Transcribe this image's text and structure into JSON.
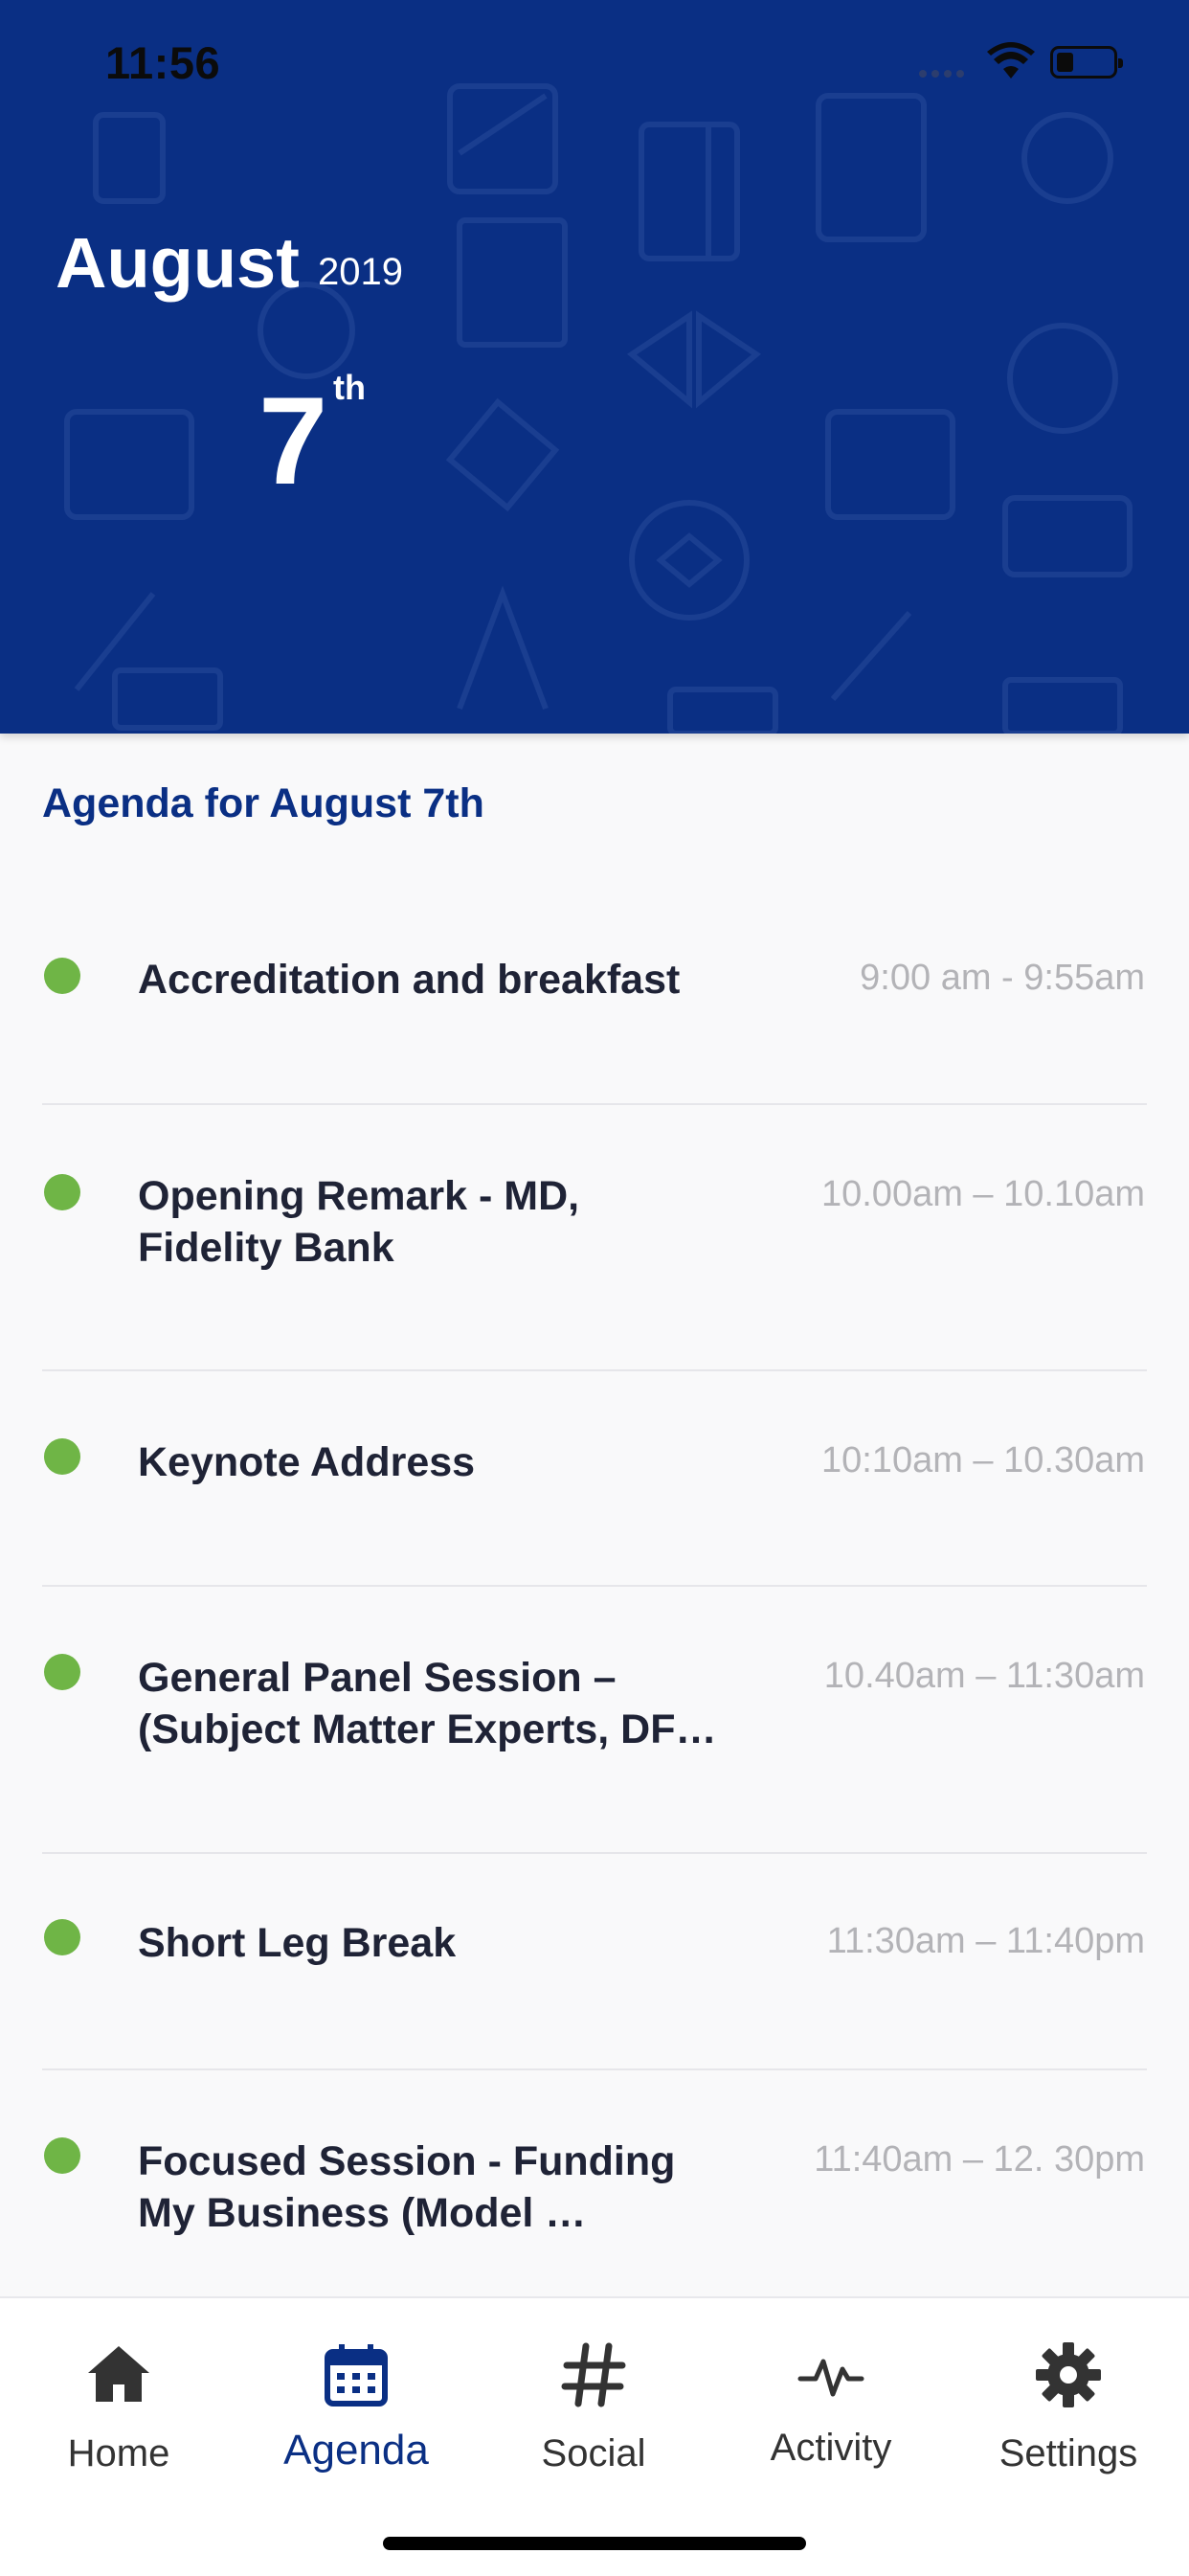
{
  "status_bar": {
    "time": "11:56"
  },
  "header": {
    "month": "August",
    "year": "2019",
    "day": "7",
    "day_suffix": "th"
  },
  "agenda": {
    "title": "Agenda for August 7th",
    "items": [
      {
        "title": "Accreditation and breakfast",
        "time": "9:00 am - 9:55am"
      },
      {
        "title": "Opening Remark - MD, Fidelity Bank",
        "time": "10.00am – 10.10am"
      },
      {
        "title": "Keynote Address",
        "time": "10:10am – 10.30am"
      },
      {
        "title": "General Panel Session – (Subject Matter Experts, DF…",
        "time": "10.40am – 11:30am"
      },
      {
        "title": "Short Leg Break",
        "time": "11:30am – 11:40pm"
      },
      {
        "title": "Focused Session - Funding My Business (Model …",
        "time": "11:40am – 12. 30pm"
      }
    ],
    "status_dot_color": "#6fb546"
  },
  "tabs": [
    {
      "label": "Home",
      "icon": "home-icon",
      "active": false
    },
    {
      "label": "Agenda",
      "icon": "calendar-icon",
      "active": true
    },
    {
      "label": "Social",
      "icon": "hashtag-icon",
      "active": false
    },
    {
      "label": "Activity",
      "icon": "activity-icon",
      "active": false
    },
    {
      "label": "Settings",
      "icon": "gear-icon",
      "active": false
    }
  ],
  "colors": {
    "brand": "#0a2f84",
    "accent_green": "#6fb546",
    "muted_text": "#b3b3b7",
    "title_text": "#1f2336"
  }
}
